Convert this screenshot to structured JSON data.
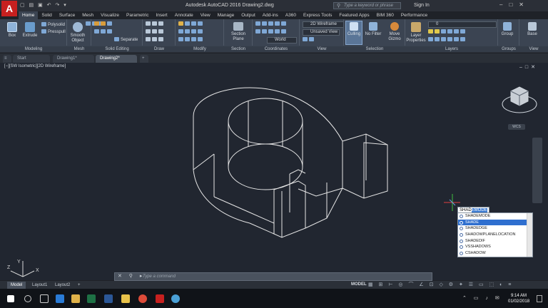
{
  "app": {
    "logo_letter": "A",
    "title": "Autodesk AutoCAD 2016    Drawing2.dwg",
    "search_placeholder": "Type a keyword or phrase",
    "sign_in": "Sign In"
  },
  "ribbon_tabs": [
    "Home",
    "Solid",
    "Surface",
    "Mesh",
    "Visualize",
    "Parametric",
    "Insert",
    "Annotate",
    "View",
    "Manage",
    "Output",
    "Add-ins",
    "A360",
    "Express Tools",
    "Featured Apps",
    "BIM 360",
    "Performance"
  ],
  "ribbon": {
    "modeling": {
      "box": "Box",
      "extrude": "Extrude",
      "polysolid": "Polysolid",
      "presspull": "Presspull",
      "label": "Modeling"
    },
    "mesh": {
      "smooth_object": "Smooth Object",
      "label": "Mesh"
    },
    "solid_editing": {
      "separate": "Separate",
      "label": "Solid Editing"
    },
    "draw": {
      "label": "Draw"
    },
    "modify": {
      "label": "Modify"
    },
    "section": {
      "section_plane": "Section Plane",
      "label": "Section"
    },
    "coordinates": {
      "world": "World",
      "label": "Coordinates"
    },
    "view": {
      "visual_style": "2D Wireframe",
      "named_view": "Unsaved View",
      "label": "View"
    },
    "selection": {
      "culling": "Culling",
      "no_filter": "No Filter",
      "move_gizmo": "Move Gizmo",
      "label": "Selection"
    },
    "layers": {
      "layer_properties": "Layer Properties",
      "current_layer": "0",
      "label": "Layers"
    },
    "groups": {
      "group": "Group",
      "label": "Groups"
    },
    "view2": {
      "base": "Base",
      "label": "View"
    }
  },
  "file_tabs": [
    "Start",
    "Drawing1*",
    "Drawing2*"
  ],
  "viewport": {
    "label": "[−][SW Isometric][2D Wireframe]",
    "wcs": "WCS",
    "ucs_axes": [
      "Y",
      "X",
      "Z"
    ]
  },
  "autocomplete": {
    "typed": "SHAD",
    "suggested": "EMODE",
    "items": [
      "SHADEMODE",
      "SHADE",
      "SHADEDGE",
      "SHADOWPLANELOCATION",
      "SHADEDIF",
      "VSSHADOWS",
      "CSHADOW"
    ],
    "selected_index": 1
  },
  "command_line": {
    "placeholder": "Type a command"
  },
  "layout_tabs": [
    "Model",
    "Layout1",
    "Layout2"
  ],
  "status": {
    "model": "MODEL"
  },
  "taskbar": {
    "time": "9:14 AM",
    "date": "01/02/2018"
  },
  "colors": {
    "accent": "#2f6fcf",
    "wireframe": "#e6e6e6",
    "viewport_bg": "#212630",
    "logo": "#c7201f"
  }
}
